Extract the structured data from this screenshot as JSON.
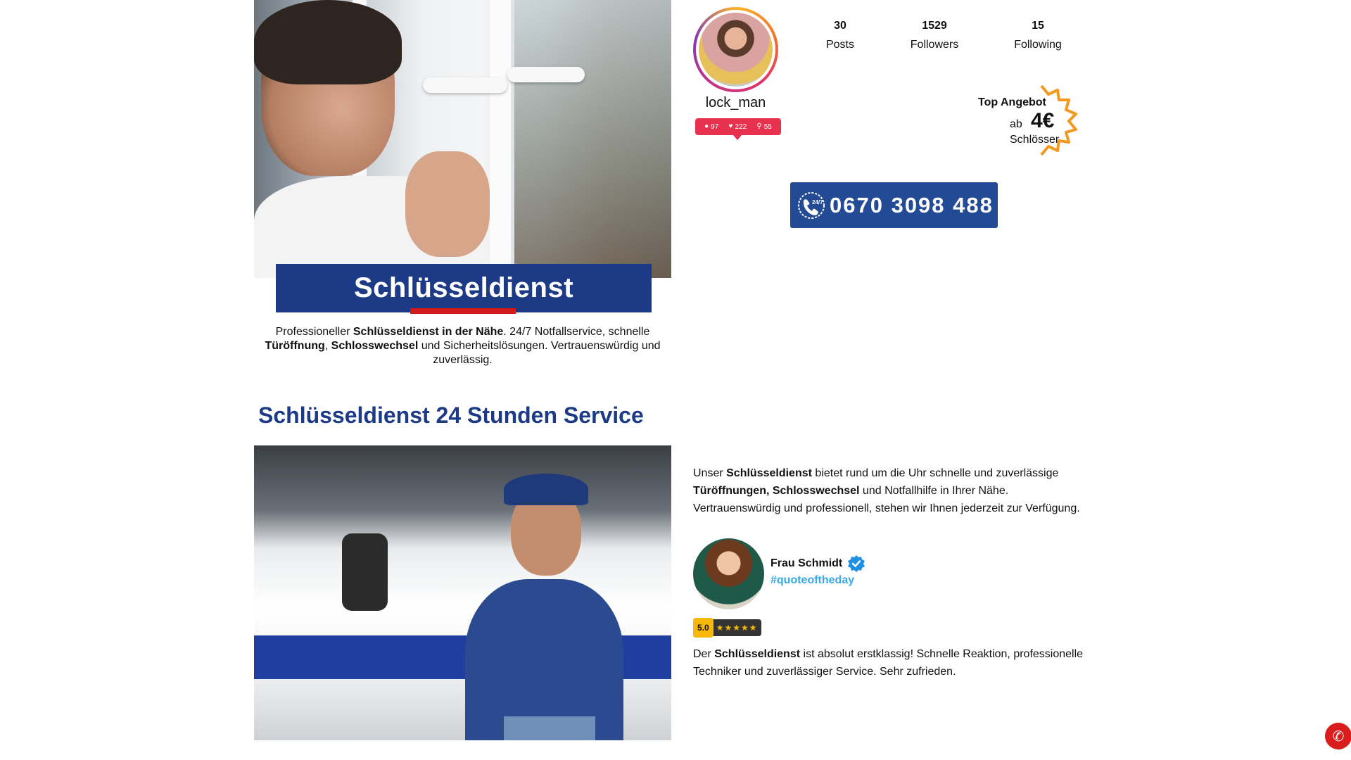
{
  "hero": {
    "title": "Schlüsseldienst",
    "intro_parts": {
      "p1": "Professioneller ",
      "b1": "Schlüsseldienst in der Nähe",
      "p2": ". 24/7 Notfallservice, schnelle ",
      "b2": "Türöffnung",
      "p3": ", ",
      "b3": "Schlosswechsel",
      "p4": " und Sicherheitslösungen. Vertrauenswürdig und zuverlässig."
    }
  },
  "profile": {
    "username": "lock_man",
    "stats": [
      {
        "num": "30",
        "label": "Posts"
      },
      {
        "num": "1529",
        "label": "Followers"
      },
      {
        "num": "15",
        "label": "Following"
      }
    ],
    "pill": {
      "comments": "97",
      "likes": "222",
      "followers": "55"
    }
  },
  "offer": {
    "title": "Top Angebot",
    "prefix": "ab",
    "price": "4€",
    "subtitle": "Schlösser"
  },
  "phone": {
    "number": "0670 3098 488",
    "icon": "phone-24-7-icon"
  },
  "section": {
    "heading": "Schlüsseldienst 24 Stunden Service",
    "desc_parts": {
      "p1": "Unser ",
      "b1": "Schlüsseldienst",
      "p2": " bietet rund um die Uhr schnelle und zuverlässige ",
      "b2": "Türöffnungen, Schlosswechsel",
      "p3": " und Notfallhilfe in Ihrer Nähe. Vertrauenswürdig und professionell, stehen wir Ihnen jederzeit zur Verfügung."
    }
  },
  "review": {
    "name": "Frau Schmidt",
    "hashtag": "#quoteoftheday",
    "score": "5.0",
    "stars": "★★★★★",
    "text_parts": {
      "p1": "Der ",
      "b1": "Schlüsseldienst",
      "p2": " ist absolut erstklassig! Schnelle Reaktion, professionelle Techniker und zuverlässiger Service. Sehr zufrieden."
    }
  },
  "colors": {
    "brand_blue": "#1c3a85",
    "accent_red": "#d11a1a",
    "pill_pink": "#e8304f",
    "hashtag_blue": "#3aa8e8",
    "star_gold": "#f6b80b"
  }
}
